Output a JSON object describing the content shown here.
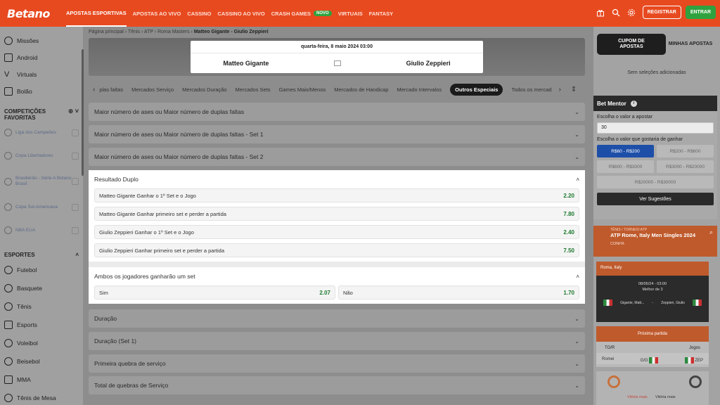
{
  "header": {
    "logo": "Betano",
    "nav": [
      {
        "label": "APOSTAS ESPORTIVAS",
        "active": true
      },
      {
        "label": "APOSTAS AO VIVO"
      },
      {
        "label": "CASSINO"
      },
      {
        "label": "CASSINO AO VIVO"
      },
      {
        "label": "CRASH GAMES",
        "badge": "NOVO"
      },
      {
        "label": "VIRTUAIS"
      },
      {
        "label": "FANTASY"
      }
    ],
    "register_label": "REGISTRAR",
    "login_label": "ENTRAR",
    "colors": {
      "brand": "#e84a20",
      "green": "#2fa23f"
    }
  },
  "sidebar": {
    "items_top": [
      {
        "label": "Missões",
        "icon": "target-icon"
      },
      {
        "label": "Android",
        "icon": "android-icon"
      },
      {
        "label": "Virtuals",
        "icon": "virtuals-icon"
      },
      {
        "label": "Bolão",
        "icon": "bolao-icon"
      }
    ],
    "favorites_title": "COMPETIÇÕES FAVORITAS",
    "favorites": [
      {
        "label": "Liga dos Campeões"
      },
      {
        "label": "Copa Libertadores"
      },
      {
        "label": "Brasileirão - Série A Betano Brasil"
      },
      {
        "label": "Copa Sul-Americana"
      },
      {
        "label": "NBA EUA"
      }
    ],
    "sports_title": "ESPORTES",
    "sports": [
      {
        "label": "Futebol",
        "icon": "soccer-ball-icon"
      },
      {
        "label": "Basquete",
        "icon": "basketball-icon"
      },
      {
        "label": "Tênis",
        "icon": "tennis-ball-icon"
      },
      {
        "label": "Esports",
        "icon": "gamepad-icon"
      },
      {
        "label": "Voleibol",
        "icon": "volleyball-icon"
      },
      {
        "label": "Beisebol",
        "icon": "baseball-icon"
      },
      {
        "label": "MMA",
        "icon": "mma-glove-icon"
      },
      {
        "label": "Tênis de Mesa",
        "icon": "table-tennis-icon"
      }
    ]
  },
  "breadcrumb": {
    "items": [
      "Página principal",
      "Tênis",
      "ATP",
      "Roma Masters"
    ],
    "current": "Matteo Gigante - Giulio Zeppieri"
  },
  "match": {
    "date": "quarta-feira, 8 maio 2024 03:00",
    "home": "Matteo Gigante",
    "away": "Giulio Zeppieri"
  },
  "tabs": [
    {
      "label": "plas faltas"
    },
    {
      "label": "Mercados Serviço"
    },
    {
      "label": "Mercados Duração"
    },
    {
      "label": "Mercados Sets"
    },
    {
      "label": "Games Mais/Menos"
    },
    {
      "label": "Mercados de Handicap"
    },
    {
      "label": "Mercado Intervalos"
    },
    {
      "label": "Outros Especiais",
      "active": true
    },
    {
      "label": "Todos os mercad"
    }
  ],
  "markets_collapsed_top": [
    "Maior número de ases ou Maior número de duplas faltas",
    "Maior número de ases ou Maior número de duplas faltas - Set 1",
    "Maior número de ases ou Maior número de duplas faltas - Set 2"
  ],
  "resultado_duplo": {
    "title": "Resultado Duplo",
    "rows": [
      {
        "label": "Matteo Gigante Ganhar o 1º Set e o Jogo",
        "odd": "2.20"
      },
      {
        "label": "Matteo Gigante Ganhar primeiro set e perder a partida",
        "odd": "7.80"
      },
      {
        "label": "Giulio Zeppieri Ganhar o 1º Set e o Jogo",
        "odd": "2.40"
      },
      {
        "label": "Giulio Zeppieri Ganhar primeiro set e perder a partida",
        "odd": "7.50"
      }
    ]
  },
  "ambos": {
    "title": "Ambos os jogadores ganharão um set",
    "yes_label": "Sim",
    "yes_odd": "2.07",
    "no_label": "Não",
    "no_odd": "1.70"
  },
  "markets_collapsed_bottom": [
    "Duração",
    "Duração (Set 1)",
    "Primeira quebra de serviço",
    "Total de quebras de Serviço"
  ],
  "betslip": {
    "tab_active": "CUPOM DE APOSTAS",
    "tab_other": "MINHAS APOSTAS",
    "empty": "Sem seleções adicionadas"
  },
  "bet_mentor": {
    "title": "Bet Mentor",
    "stake_label": "Escolha o valor a apostar",
    "stake_value": "30",
    "win_label": "Escolha o valor que gostaria de ganhar",
    "ranges": [
      "R$60 - R$200",
      "R$200 - R$600",
      "R$600 - R$3000",
      "R$3000 - R$20000",
      "R$20000 - R$30000"
    ],
    "button": "Ver Sugestões"
  },
  "live": {
    "crumb": "TÊNIS / TORNEIO ATP",
    "title": "ATP Rome, Italy Men Singles 2024",
    "conf": "CONFR.",
    "location": "Roma, Italy",
    "datetime": "08/05/24 - 03:00",
    "format": "Melhor de 3",
    "p1": "Gigante, Matt...",
    "p2": "Zeppieri, Giulio",
    "vs": "-",
    "next_title": "Próxima partida",
    "col1": "TO/R",
    "col2": "Jogos",
    "row_name": "Romei",
    "row_val": "G/G",
    "row_away": "ZEP",
    "stat1": "Vitória mais",
    "stat2": "Vitória mais"
  }
}
